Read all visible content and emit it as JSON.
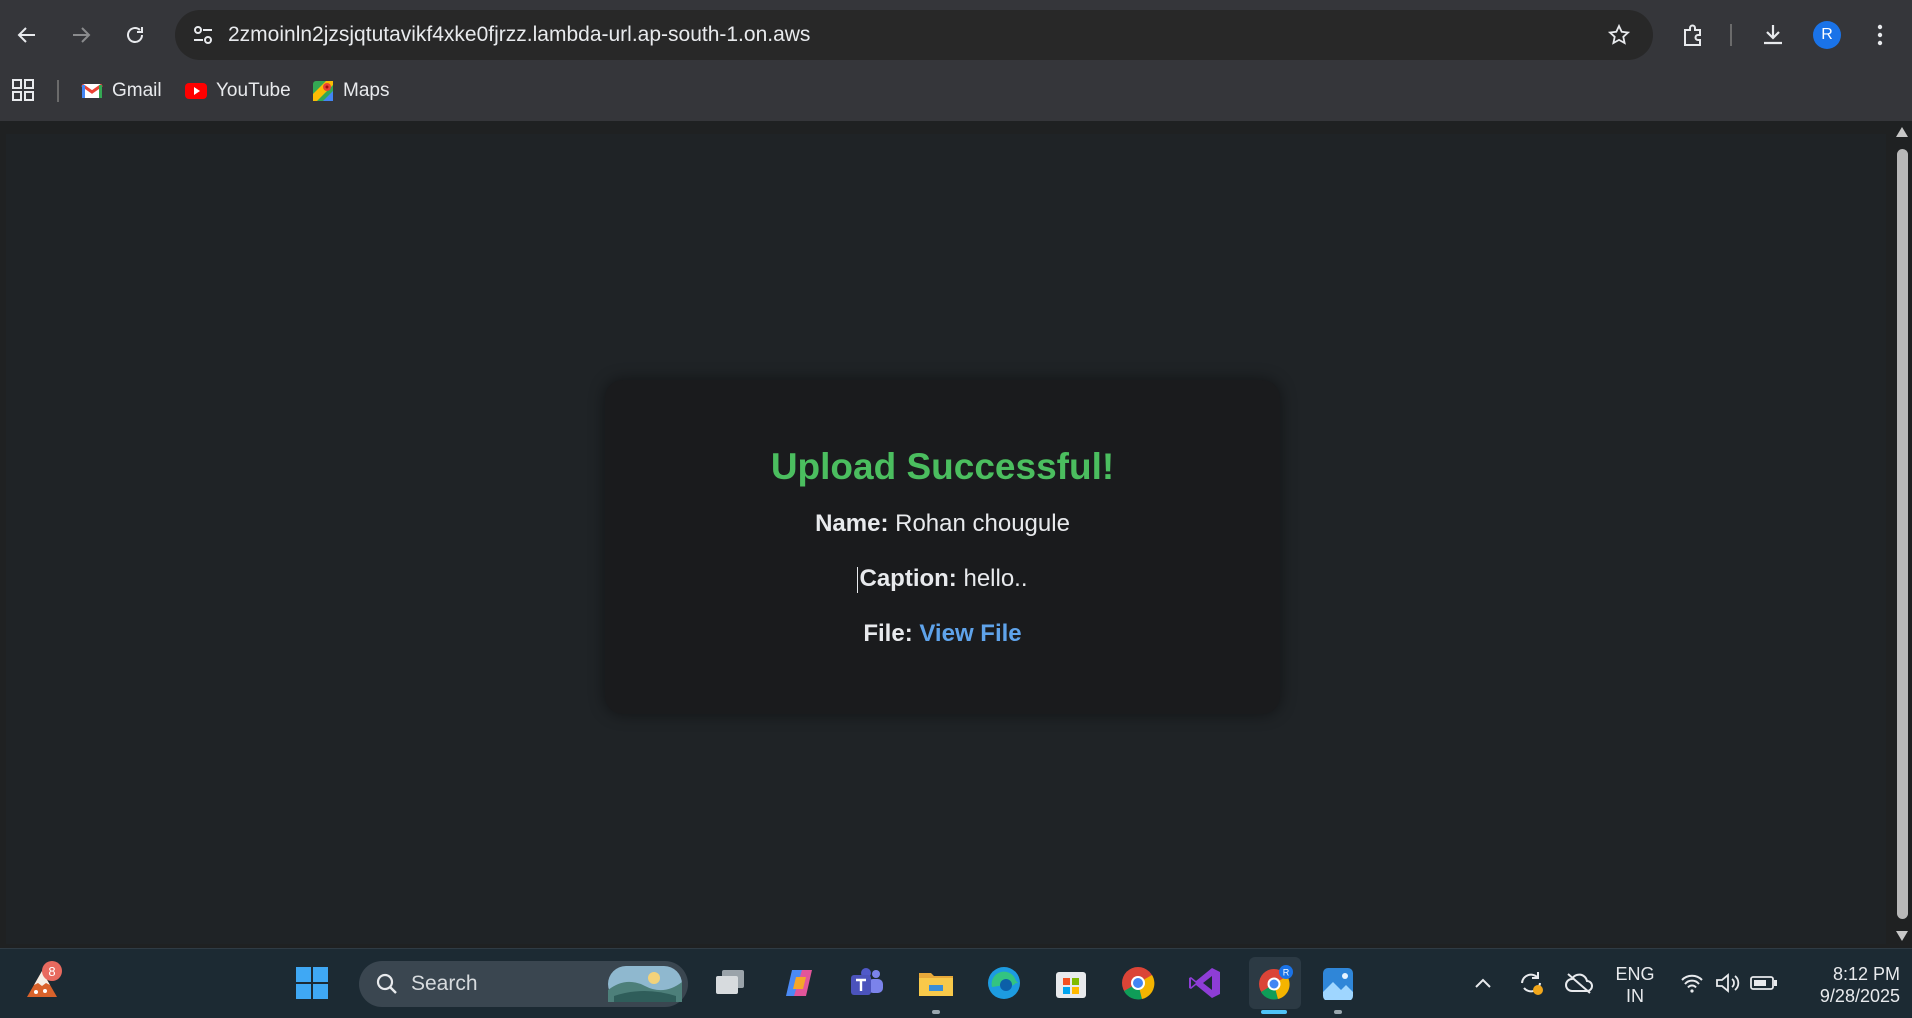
{
  "browser": {
    "url": "2zmoinln2jzsjqtutavikf4xke0fjrzz.lambda-url.ap-south-1.on.aws",
    "profile_initial": "R",
    "bookmarks": [
      {
        "label": "Gmail",
        "icon": "gmail-icon"
      },
      {
        "label": "YouTube",
        "icon": "youtube-icon"
      },
      {
        "label": "Maps",
        "icon": "maps-icon"
      }
    ]
  },
  "page": {
    "title": "Upload Successful!",
    "name_label": "Name:",
    "name_value": "Rohan chougule",
    "caption_label": "Caption:",
    "caption_value": "hello..",
    "file_label": "File:",
    "file_link": "View File",
    "colors": {
      "success": "#4bbe5f",
      "link": "#5fa3ea",
      "card": "#1a1b1d"
    }
  },
  "taskbar": {
    "search_placeholder": "Search",
    "notification_count": "8",
    "language_line1": "ENG",
    "language_line2": "IN",
    "time": "8:12 PM",
    "date": "9/28/2025"
  }
}
